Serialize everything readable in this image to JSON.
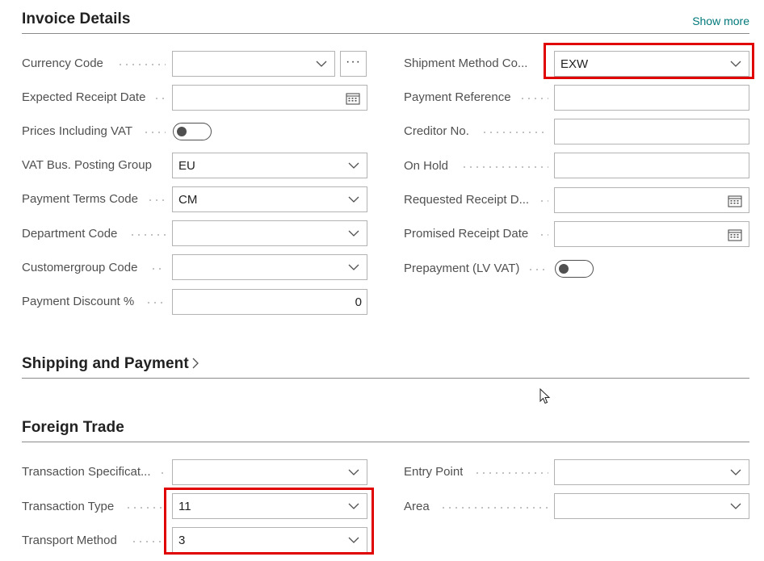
{
  "invoice_details": {
    "title": "Invoice Details",
    "show_more": "Show more",
    "left": {
      "currency_code": {
        "label": "Currency Code",
        "value": ""
      },
      "expected_receipt_date": {
        "label": "Expected Receipt Date",
        "value": ""
      },
      "prices_including_vat": {
        "label": "Prices Including VAT",
        "value": "off"
      },
      "vat_bus_posting_group": {
        "label": "VAT Bus. Posting Group",
        "value": "EU"
      },
      "payment_terms_code": {
        "label": "Payment Terms Code",
        "value": "CM"
      },
      "department_code": {
        "label": "Department Code",
        "value": ""
      },
      "customergroup_code": {
        "label": "Customergroup Code",
        "value": ""
      },
      "payment_discount": {
        "label": "Payment Discount %",
        "value": "0"
      }
    },
    "right": {
      "shipment_method_code": {
        "label": "Shipment Method Co...",
        "value": "EXW"
      },
      "payment_reference": {
        "label": "Payment Reference",
        "value": ""
      },
      "creditor_no": {
        "label": "Creditor No.",
        "value": ""
      },
      "on_hold": {
        "label": "On Hold",
        "value": ""
      },
      "requested_receipt_date": {
        "label": "Requested Receipt D...",
        "value": ""
      },
      "promised_receipt_date": {
        "label": "Promised Receipt Date",
        "value": ""
      },
      "prepayment_lv_vat": {
        "label": "Prepayment (LV VAT)",
        "value": "off"
      }
    }
  },
  "shipping_and_payment": {
    "title": "Shipping and Payment"
  },
  "foreign_trade": {
    "title": "Foreign Trade",
    "left": {
      "transaction_specification": {
        "label": "Transaction Specificat...",
        "value": ""
      },
      "transaction_type": {
        "label": "Transaction Type",
        "value": "11"
      },
      "transport_method": {
        "label": "Transport Method",
        "value": "3"
      }
    },
    "right": {
      "entry_point": {
        "label": "Entry Point",
        "value": ""
      },
      "area": {
        "label": "Area",
        "value": ""
      }
    }
  },
  "icons": {
    "dropdown": "chevron-down-icon",
    "calendar": "calendar-icon",
    "lookup": "ellipsis-icon",
    "expand": "chevron-right-icon",
    "cursor": "mouse-pointer-icon"
  },
  "colors": {
    "highlight": "#e00000",
    "link": "#00787a",
    "label": "#505050"
  }
}
